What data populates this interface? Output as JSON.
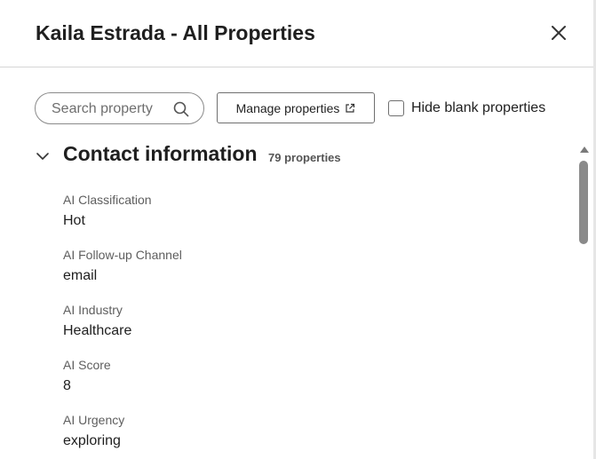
{
  "header": {
    "title": "Kaila Estrada - All Properties",
    "close_icon": "close-icon"
  },
  "toolbar": {
    "search_placeholder": "Search property",
    "search_value": "",
    "search_icon": "search-icon",
    "manage_label": "Manage properties",
    "manage_icon": "external-link-icon",
    "hide_blank_label": "Hide blank properties",
    "hide_blank_checked": false
  },
  "section": {
    "title": "Contact information",
    "count": "79 properties",
    "expanded": true,
    "properties": [
      {
        "label": "AI Classification",
        "value": "Hot"
      },
      {
        "label": "AI Follow-up Channel",
        "value": "email"
      },
      {
        "label": "AI Industry",
        "value": "Healthcare"
      },
      {
        "label": "AI Score",
        "value": "8"
      },
      {
        "label": "AI Urgency",
        "value": "exploring"
      }
    ]
  },
  "colors": {
    "text": "#1f1f1f",
    "label": "#5e5e5e",
    "border": "#8a8a8a",
    "divider": "#d6d6d6"
  }
}
